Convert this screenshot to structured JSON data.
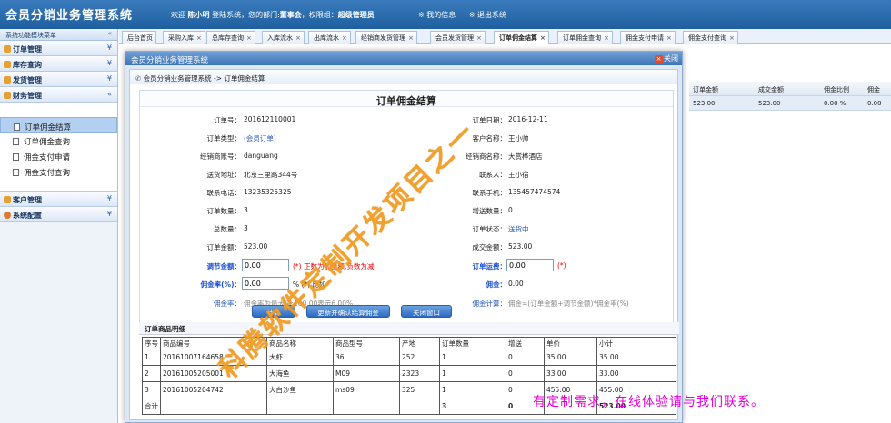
{
  "app": {
    "title": "会员分销业务管理系统"
  },
  "header": {
    "welcome_prefix": "欢迎",
    "user": "陈小明",
    "welcome_mid": "登陆系统，您的部门:",
    "dept": "董事会",
    "role_prefix": "，权限组：",
    "role": "超级管理员",
    "my_info": "※ 我的信息",
    "logout": "※ 退出系统"
  },
  "sidebar": {
    "title": "系统功能模块菜单",
    "groups": [
      {
        "label": "订单管理"
      },
      {
        "label": "库存查询"
      },
      {
        "label": "发货管理"
      },
      {
        "label": "财务管理"
      }
    ],
    "finance_items": [
      {
        "label": "订单佣金结算"
      },
      {
        "label": "订单佣金查询"
      },
      {
        "label": "佣金支付申请"
      },
      {
        "label": "佣金支付查询"
      }
    ],
    "bottom_groups": [
      {
        "label": "客户管理"
      },
      {
        "label": "系统配置"
      }
    ]
  },
  "tabs": [
    {
      "label": "后台首页"
    },
    {
      "label": "采购入库"
    },
    {
      "label": "总库存查询"
    },
    {
      "label": "入库流水"
    },
    {
      "label": "出库流水"
    },
    {
      "label": "经销商发货管理"
    },
    {
      "label": "会员发货管理"
    },
    {
      "label": "订单佣金结算"
    },
    {
      "label": "订单佣金查询"
    },
    {
      "label": "佣金支付申请"
    },
    {
      "label": "佣金支付查询"
    }
  ],
  "bg_table": {
    "headers": [
      "订单金额",
      "成交金额",
      "佣金比例",
      "佣金"
    ],
    "row": [
      "523.00",
      "523.00",
      "0.00 %",
      "0.00"
    ]
  },
  "dialog": {
    "title": "会员分销业务管理系统",
    "close": "关闭",
    "breadcrumb": "会员分销业务管理系统 -> 订单佣金结算",
    "form_title": "订单佣金结算",
    "order_no_label": "订单号：",
    "order_no": "201612110001",
    "order_date_label": "订单日期：",
    "order_date": "2016-12-11",
    "order_type_label": "订单类型：",
    "order_type": "(会员订单)",
    "customer_label": "客户名称：",
    "customer": "王小帅",
    "dealer_acct_label": "经销商账号：",
    "dealer_acct": "danguang",
    "dealer_name_label": "经销商名称：",
    "dealer_name": "大赏桦酒店",
    "addr_label": "送货地址：",
    "addr": "北京三里路344号",
    "contact_label": "联系人：",
    "contact": "王小宿",
    "phone_label": "联系电话：",
    "phone": "13235325325",
    "mobile_label": "联系手机：",
    "mobile": "135457474574",
    "qty_label": "订单数量：",
    "qty": "3",
    "gift_label": "增送数量：",
    "gift": "0",
    "total_label": "总数量：",
    "total": "3",
    "status_label": "订单状态：",
    "status": "送货中",
    "amount_label": "订单金额：",
    "amount": "523.00",
    "deal_label": "成交金额：",
    "deal": "523.00",
    "adjust_label": "调节金额：",
    "adjust": "0.00",
    "adjust_note": "(*) 正数为加金额,负数为减",
    "freight_label": "订单运费：",
    "freight": "0.00",
    "freight_note": "(*)",
    "rate_label": "佣金率(%)：",
    "rate": "0.00",
    "rate_note": "% (*) 比如",
    "comm_label": "佣金：",
    "comm": "0.00",
    "rate_tip_label": "佣金率：",
    "rate_tip": "佣金率为最大值:100.00表示6.00%",
    "calc_label": "佣金计算：",
    "calc": "佣金=(订单金额+调节金额)*佣金率(%)",
    "btn_calc": "计算",
    "btn_update": "更新并确认结算佣金",
    "btn_close": "关闭窗口"
  },
  "detail": {
    "title": "订单商品明细",
    "headers": [
      "序号",
      "商品编号",
      "商品名称",
      "商品型号",
      "产地",
      "订单数量",
      "增送",
      "单价",
      "小计"
    ],
    "rows": [
      [
        "1",
        "20161007164658",
        "大虾",
        "36",
        "252",
        "1",
        "0",
        "35.00",
        "35.00"
      ],
      [
        "2",
        "20161005205001",
        "大海鱼",
        "M09",
        "2323",
        "1",
        "0",
        "33.00",
        "33.00"
      ],
      [
        "3",
        "20161005204742",
        "大白沙鱼",
        "ms09",
        "325",
        "1",
        "0",
        "455.00",
        "455.00"
      ]
    ],
    "total_row": [
      "合计",
      "",
      "",
      "",
      "",
      "3",
      "0",
      "",
      "523.00"
    ]
  },
  "watermark": {
    "diag": "科腾软件定制开发项目之一",
    "note": "有定制需求，在线体验请与我们联系。"
  }
}
